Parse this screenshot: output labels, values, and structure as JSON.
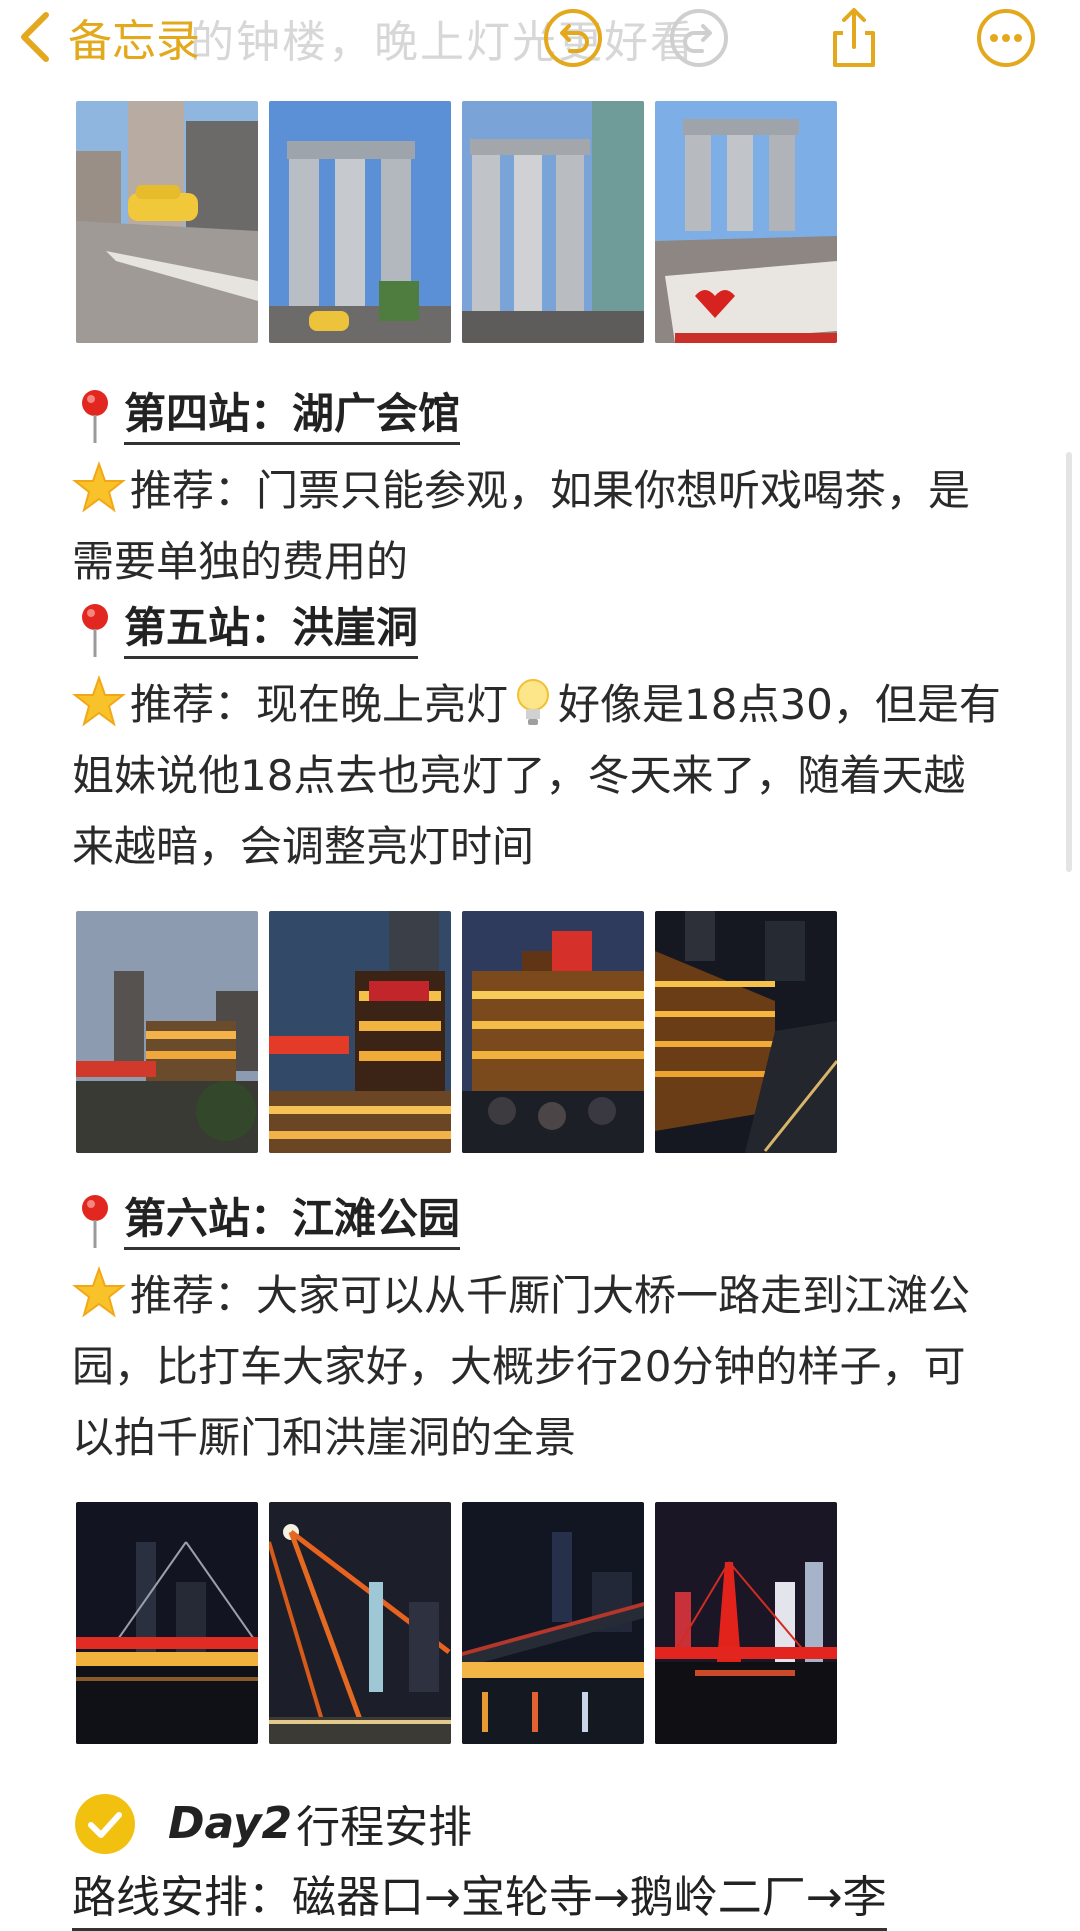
{
  "nav": {
    "back_label": "备忘录",
    "ghost_text": "的钟楼，晚上灯光更好看"
  },
  "sections": [
    {
      "title": "第四站：湖广会馆",
      "text": "推荐：门票只能参观，如果你想听戏喝茶，是需要单独的费用的"
    },
    {
      "title": "第五站：洪崖洞",
      "text_before": "推荐：现在晚上亮灯",
      "text_after": "好像是18点30，但是有姐妹说他18点去也亮灯了，冬天来了，随着天越来越暗，会调整亮灯时间"
    },
    {
      "title": "第六站：江滩公园",
      "text": "推荐：大家可以从千厮门大桥一路走到江滩公园，比打车大家好，大概步行20分钟的样子，可以拍千厮门和洪崖洞的全景"
    }
  ],
  "day2": {
    "en": "Day2",
    "label": "行程安排"
  },
  "route": {
    "text": "路线安排：磁器口→宝轮寺→鹅岭二厂→李"
  },
  "photos": {
    "row1": [
      "street-taxi-photo",
      "raffles-towers-photo",
      "raffles-towers-street-photo",
      "i-love-cq-photo"
    ],
    "row2": [
      "hongyadong-dusk-photo",
      "hongyadong-gate-photo",
      "hongyadong-crowd-photo",
      "hongyadong-night-photo"
    ],
    "row3": [
      "qiansimen-bridge-photo",
      "bridge-cables-photo",
      "river-bridge-photo",
      "red-bridge-photo"
    ]
  },
  "colors": {
    "accent": "#e3a81b",
    "check_yellow": "#f2c10f",
    "text": "#2a2a2a"
  }
}
